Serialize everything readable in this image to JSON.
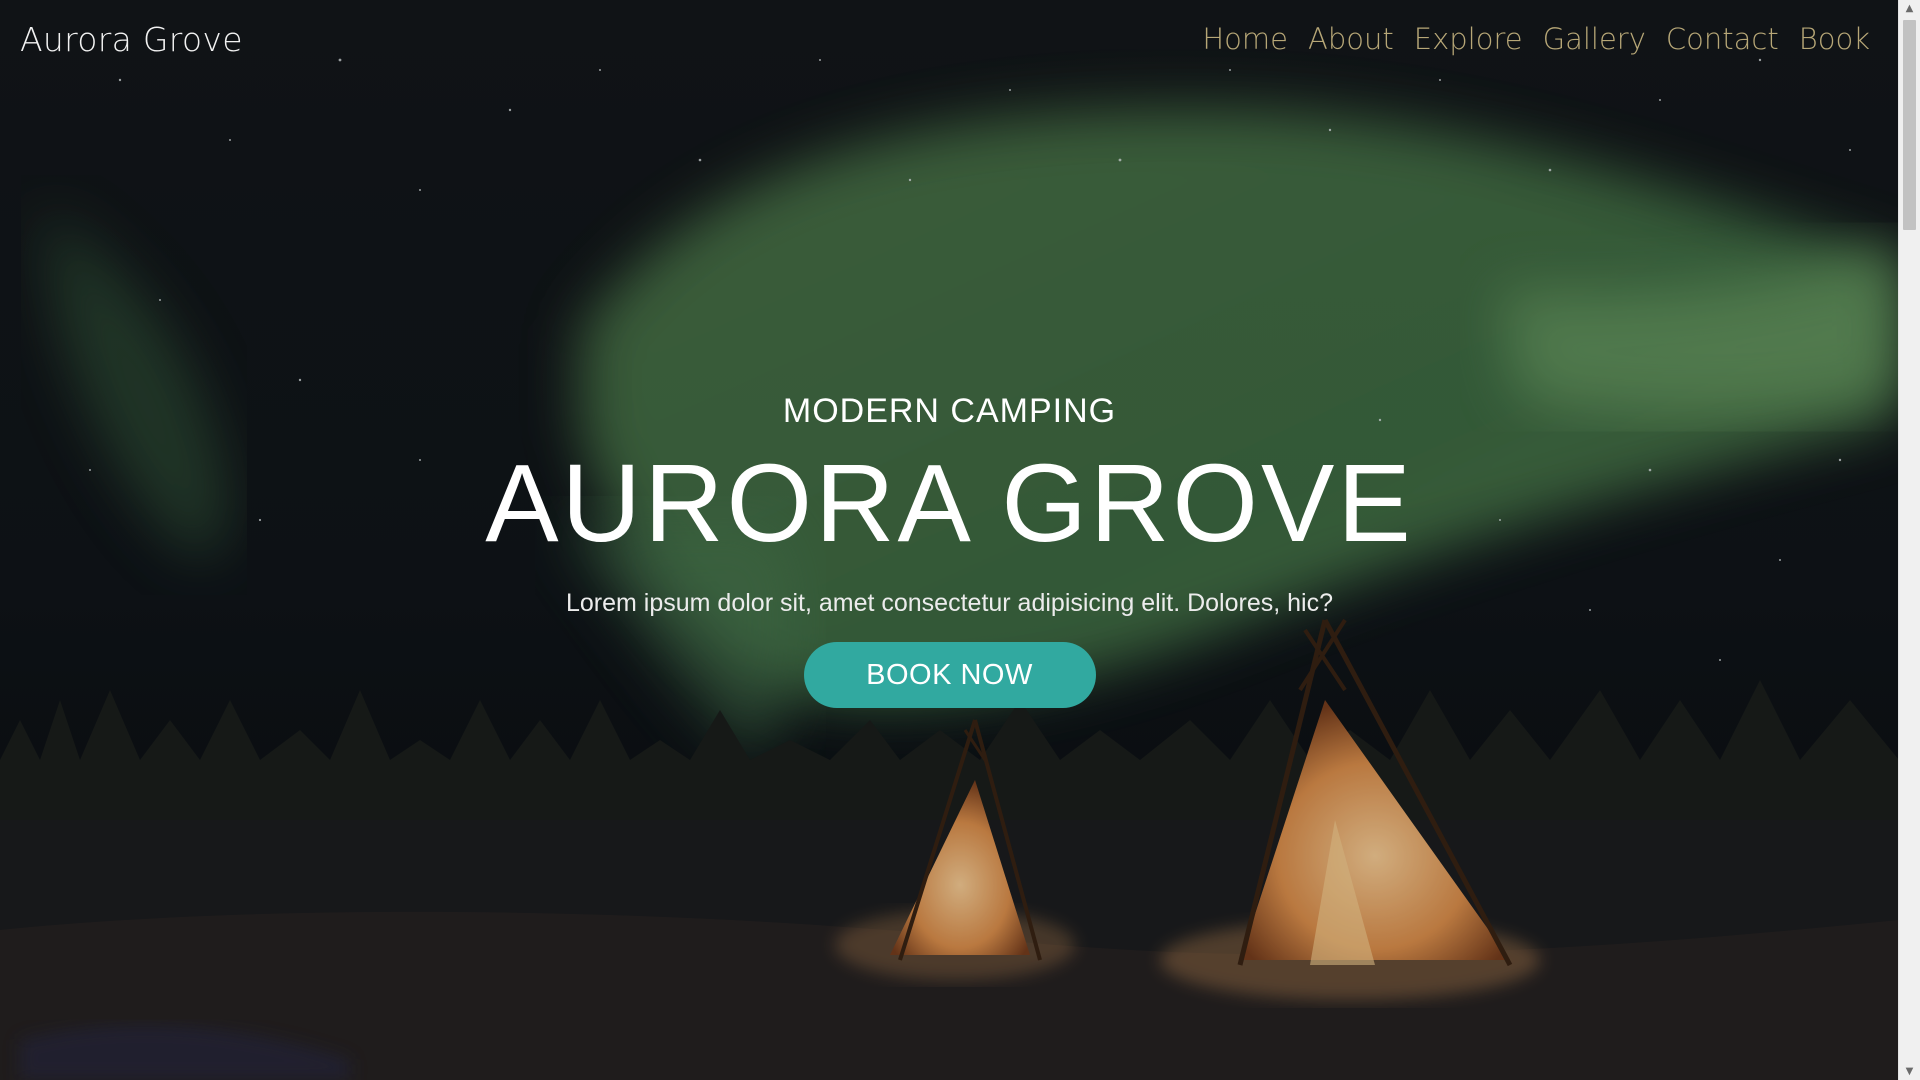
{
  "header": {
    "brand": "Aurora Grove",
    "nav": [
      "Home",
      "About",
      "Explore",
      "Gallery",
      "Contact",
      "Book"
    ]
  },
  "hero": {
    "kicker": "MODERN CAMPING",
    "title": "AURORA GROVE",
    "lede": "Lorem ipsum dolor sit, amet consectetur adipisicing elit. Dolores, hic?",
    "cta": "BOOK NOW"
  },
  "colors": {
    "nav_text": "#b7a777",
    "cta_bg": "#31a9a0",
    "aurora": "#5e9a5a"
  },
  "scrollbar": {
    "position_fraction": 0.0
  }
}
